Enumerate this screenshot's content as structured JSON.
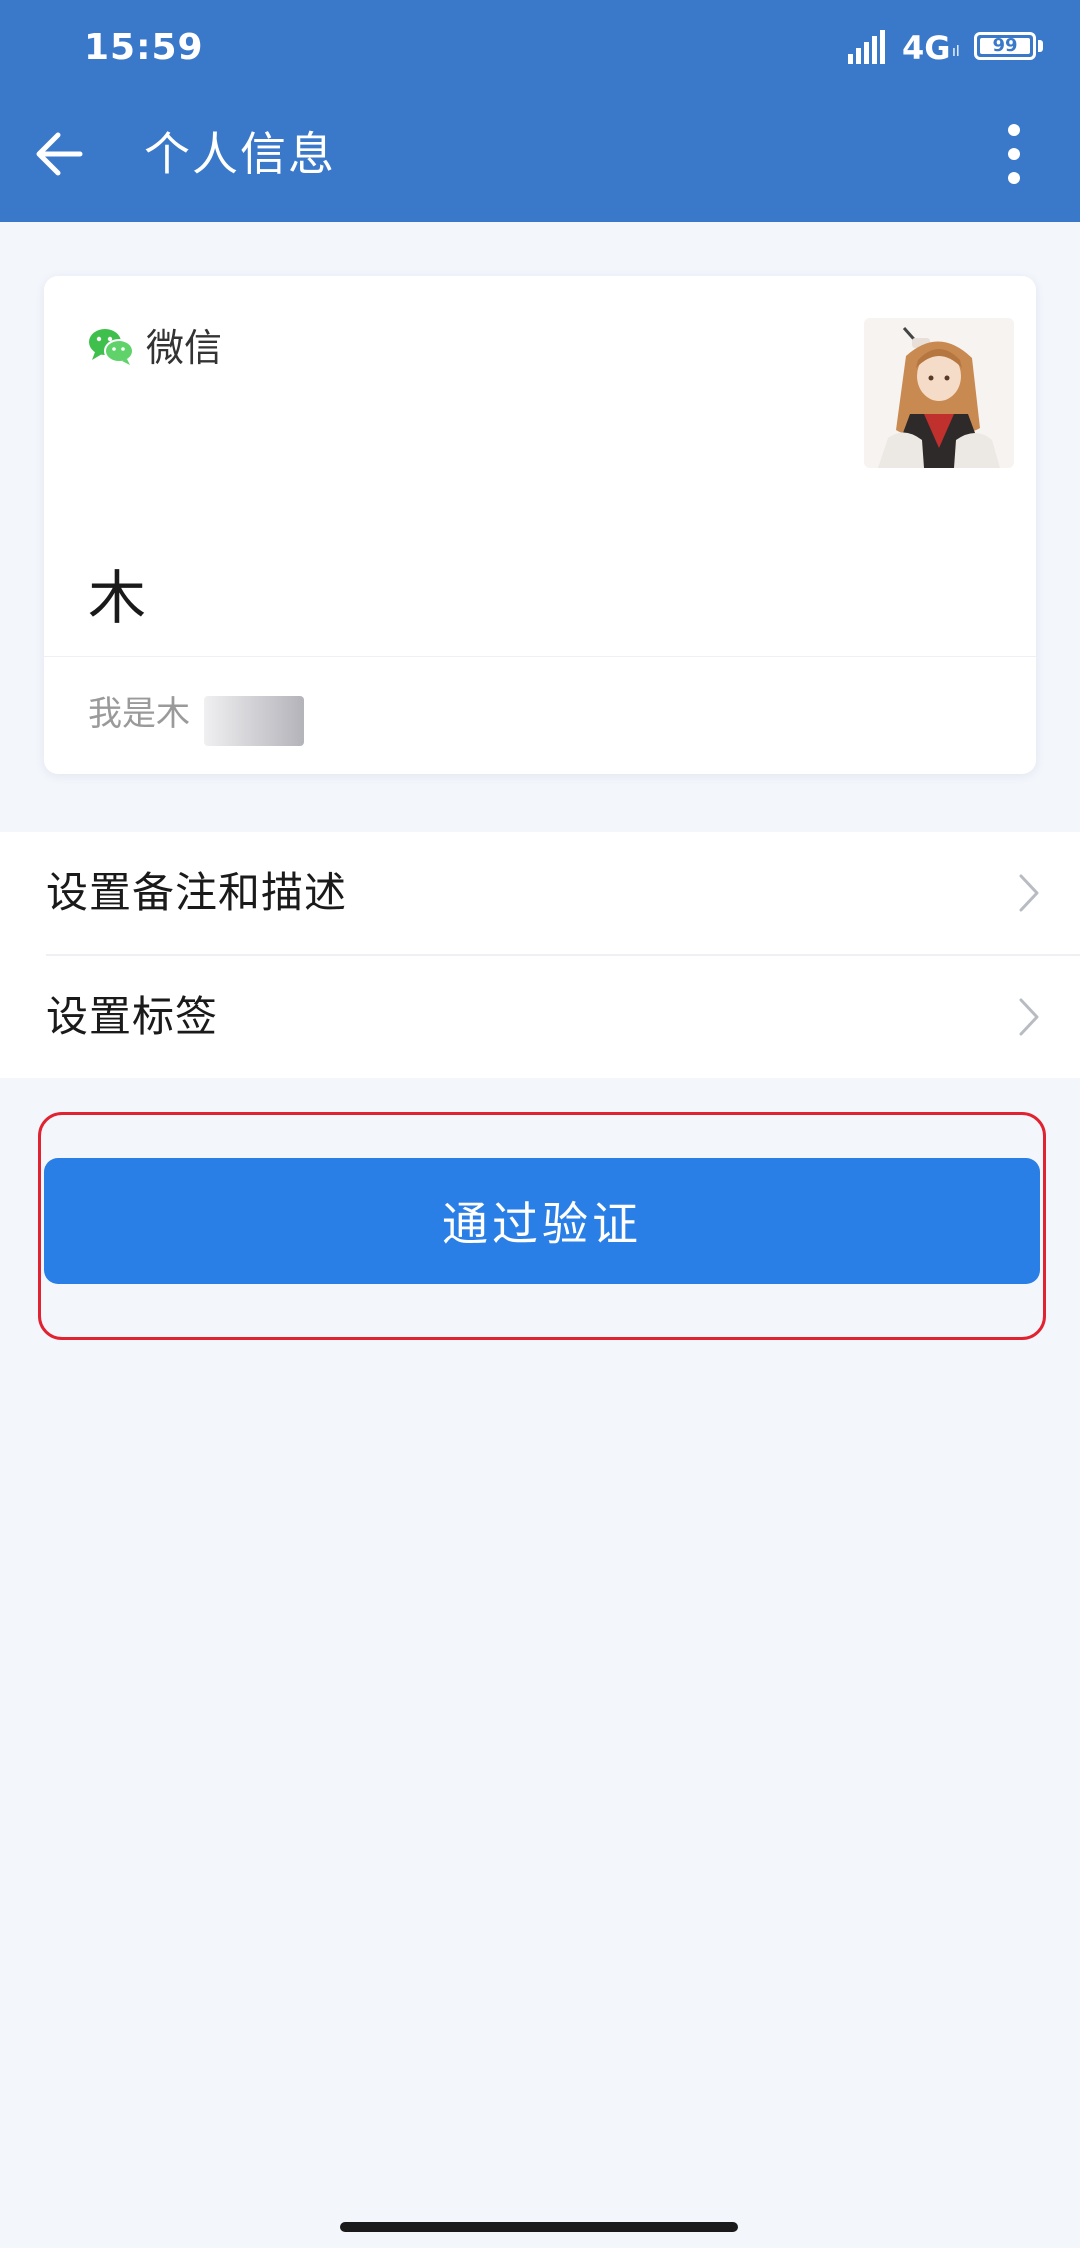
{
  "status_bar": {
    "time": "15:59",
    "network": "4G",
    "network_sub": "ıl",
    "battery": "99"
  },
  "header": {
    "title": "个人信息"
  },
  "profile": {
    "source_label": "微信",
    "nickname": "木",
    "verify_message": "我是木"
  },
  "settings": {
    "items": [
      {
        "label": "设置备注和描述"
      },
      {
        "label": "设置标签"
      }
    ]
  },
  "actions": {
    "verify_button_label": "通过验证"
  },
  "colors": {
    "header_bg": "#3a78c9",
    "button_bg": "#2a7fe6",
    "highlight_border": "#e02231",
    "wechat_green": "#3fbf4c",
    "page_bg": "#f3f6fb"
  },
  "icons": {
    "back": "back-arrow-icon",
    "more": "more-vertical-icon",
    "source": "wechat-icon",
    "row_chevron": "chevron-right-icon",
    "signal": "signal-icon"
  }
}
